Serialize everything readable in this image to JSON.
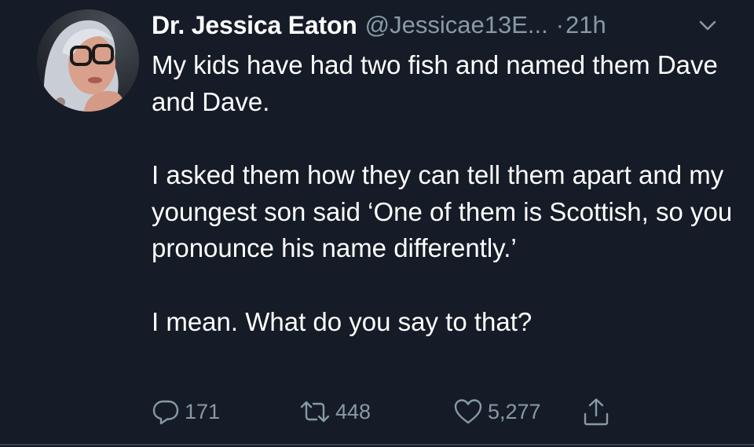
{
  "tweet": {
    "display_name": "Dr. Jessica Eaton",
    "handle": "@Jessicae13E...",
    "dot": "·",
    "time": "21h",
    "paragraphs": [
      "My kids have had two fish and named them Dave and Dave.",
      "I asked them how they can tell them apart and my youngest son said ‘One of them is Scottish, so you pronounce his name differently.’",
      "I mean. What do you say to that?"
    ],
    "actions": {
      "reply_icon": "reply-icon",
      "reply_count": "171",
      "retweet_icon": "retweet-icon",
      "retweet_count": "448",
      "like_icon": "heart-icon",
      "like_count": "5,277",
      "share_icon": "share-icon"
    },
    "colors": {
      "background": "#151c27",
      "text": "#ffffff",
      "secondary": "#8899a6"
    }
  }
}
